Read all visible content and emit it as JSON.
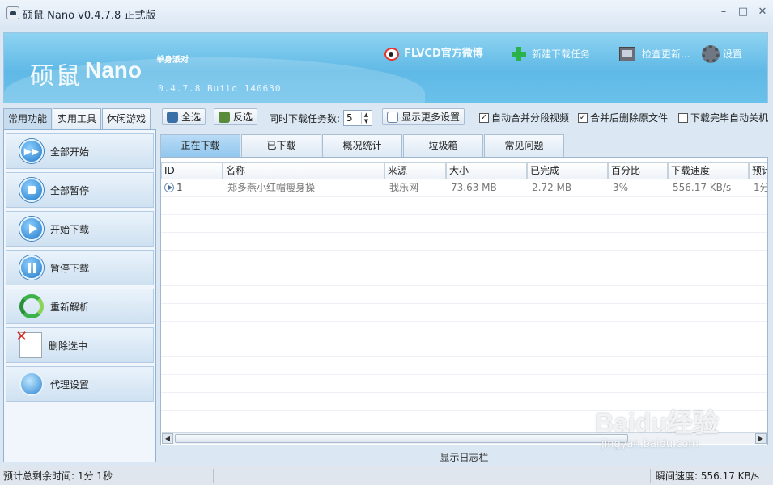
{
  "window": {
    "title": "硕鼠 Nano v0.4.7.8 正式版"
  },
  "banner": {
    "logo_cn": "硕鼠",
    "logo_en": "Nano",
    "tagline": "单身派对",
    "version": "0.4.7.8 Build 140630",
    "links": {
      "weibo": "FLVCD官方微博",
      "new_task": "新建下载任务",
      "check_update": "检查更新...",
      "settings": "设置"
    }
  },
  "left_tabs": [
    "常用功能",
    "实用工具",
    "休闲游戏"
  ],
  "left_actions": [
    "全部开始",
    "全部暂停",
    "开始下载",
    "暂停下载",
    "重新解析",
    "删除选中",
    "代理设置"
  ],
  "toolbar": {
    "select_all": "全选",
    "invert": "反选",
    "concurrent_label": "同时下载任务数:",
    "concurrent_value": "5",
    "more_settings": "显示更多设置",
    "opt_merge": "自动合并分段视频",
    "opt_delete_after_merge": "合并后删除原文件",
    "opt_shutdown": "下载完毕自动关机"
  },
  "main_tabs": [
    "正在下载",
    "已下载",
    "概况统计",
    "垃圾箱",
    "常见问题"
  ],
  "table": {
    "headers": [
      "ID",
      "名称",
      "来源",
      "大小",
      "已完成",
      "百分比",
      "下载速度",
      "预计"
    ],
    "rows": [
      [
        "1",
        "郑多燕小红帽瘦身操",
        "我乐网",
        "73.63 MB",
        "2.72 MB",
        "3%",
        "556.17 KB/s",
        "1分"
      ]
    ]
  },
  "log_toggle": "显示日志栏",
  "status": {
    "remaining": "预计总剩余时间:  1分 1秒",
    "speed": "瞬间速度:  556.17 KB/s"
  },
  "watermark": {
    "main": "Baidu经验",
    "sub": "jingyan.baidu.com"
  },
  "colors": {
    "banner": "#6ac1ea",
    "active_tab": "#92c7ee",
    "panel": "#f0f6fc"
  }
}
